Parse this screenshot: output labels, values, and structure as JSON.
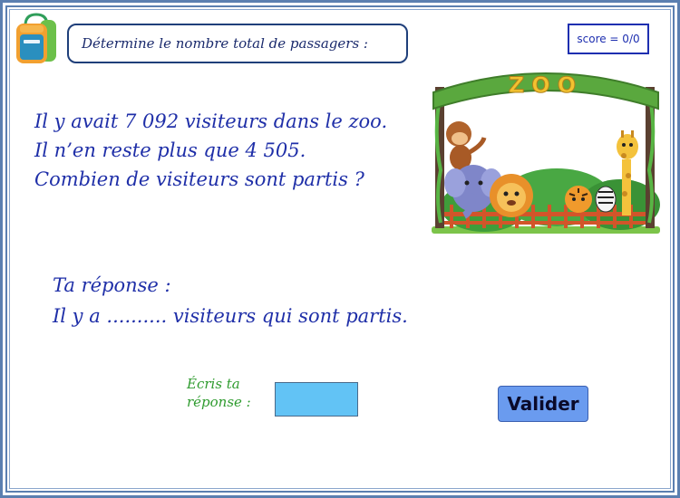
{
  "header": {
    "instruction": "Détermine le nombre total de passagers :",
    "score": "score = 0/0"
  },
  "problem": {
    "lines": [
      "Il y avait 7 092 visiteurs dans le  zoo.",
      "Il n’en reste plus que 4 505.",
      "Combien de visiteurs sont partis ?"
    ]
  },
  "illustration": {
    "sign_text": "ZOO"
  },
  "answer": {
    "line1": "Ta réponse :",
    "line2": "Il y a .......... visiteurs qui sont partis."
  },
  "input": {
    "label_line1": "Écris ta",
    "label_line2": "réponse :",
    "value": ""
  },
  "buttons": {
    "validate_label": "Valider"
  },
  "icons": {
    "backpack": "backpack-icon"
  },
  "colors": {
    "frame": "#5b7fb0",
    "text_blue": "#1f2fa8",
    "label_green": "#2e9b2e",
    "input_fill": "#62c3f5",
    "button_fill": "#6a9bef"
  }
}
